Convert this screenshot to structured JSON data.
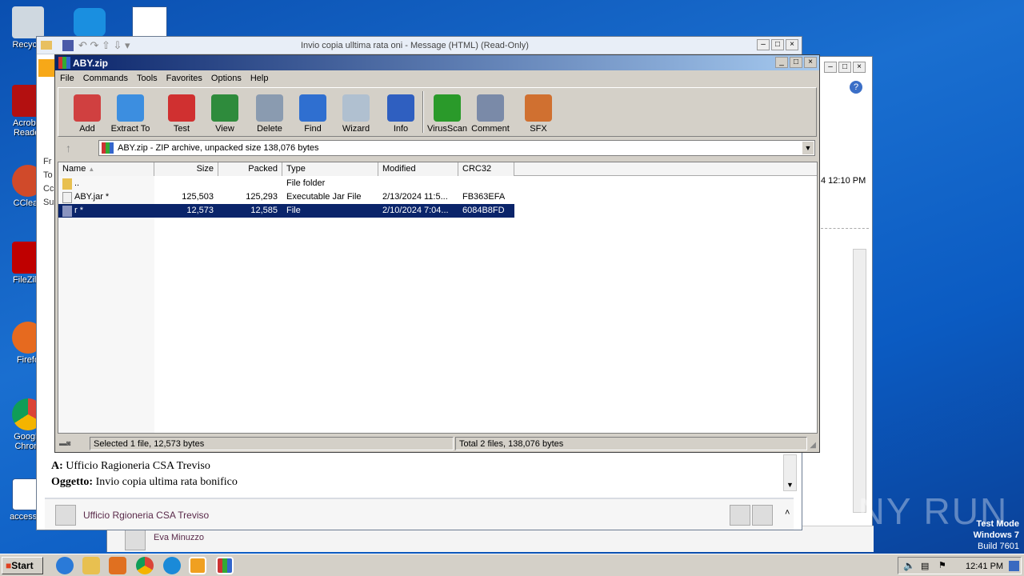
{
  "desktop": {
    "icons": [
      {
        "label": "Recycle"
      },
      {
        "label": "Acrobat Reader"
      },
      {
        "label": "CClean"
      },
      {
        "label": "FileZilla"
      },
      {
        "label": "Firefo"
      },
      {
        "label": "Google Chrom"
      },
      {
        "label": "accessac"
      }
    ]
  },
  "back_window": {
    "time_fragment": "4 12:10 PM",
    "person": "Eva Minuzzo"
  },
  "outlook": {
    "title": "Invio copia ulltima rata oni  -  Message (HTML) (Read-Only)",
    "header_labels": [
      "Fr",
      "To",
      "Cc",
      "Su"
    ],
    "body": {
      "to_label": "A:",
      "to_value": "Ufficio Ragioneria CSA Treviso",
      "subject_label": "Oggetto:",
      "subject_value": "Invio copia ultima rata bonifico"
    },
    "person": "Ufficio Rgioneria CSA Treviso"
  },
  "winrar": {
    "title": "ABY.zip",
    "menu": [
      "File",
      "Commands",
      "Tools",
      "Favorites",
      "Options",
      "Help"
    ],
    "toolbar": [
      {
        "label": "Add",
        "icon": "archive-books-icon",
        "color": "#d04040"
      },
      {
        "label": "Extract To",
        "icon": "folder-icon",
        "color": "#3c8ee0"
      },
      {
        "label": "Test",
        "icon": "checklist-icon",
        "color": "#d03030"
      },
      {
        "label": "View",
        "icon": "book-icon",
        "color": "#2e8b3c"
      },
      {
        "label": "Delete",
        "icon": "trash-icon",
        "color": "#8a9bb0"
      },
      {
        "label": "Find",
        "icon": "magnifier-icon",
        "color": "#2f6fd0"
      },
      {
        "label": "Wizard",
        "icon": "wand-icon",
        "color": "#b0c0d0"
      },
      {
        "label": "Info",
        "icon": "info-icon",
        "color": "#2f5fc0"
      },
      {
        "label": "VirusScan",
        "icon": "bug-icon",
        "color": "#2a9a2a"
      },
      {
        "label": "Comment",
        "icon": "comment-icon",
        "color": "#7a8aa8"
      },
      {
        "label": "SFX",
        "icon": "sfx-books-icon",
        "color": "#d07030"
      }
    ],
    "address": "ABY.zip - ZIP archive, unpacked size 138,076 bytes",
    "columns": [
      "Name",
      "Size",
      "Packed",
      "Type",
      "Modified",
      "CRC32"
    ],
    "rows": [
      {
        "name": "..",
        "size": "",
        "packed": "",
        "type": "File folder",
        "modified": "",
        "crc": "",
        "icon": "folder-icon"
      },
      {
        "name": "ABY.jar *",
        "size": "125,503",
        "packed": "125,293",
        "type": "Executable Jar File",
        "modified": "2/13/2024 11:5...",
        "crc": "FB363EFA",
        "icon": "jar-file-icon"
      },
      {
        "name": "r *",
        "size": "12,573",
        "packed": "12,585",
        "type": "File",
        "modified": "2/10/2024 7:04...",
        "crc": "6084B8FD",
        "icon": "file-icon",
        "selected": true
      }
    ],
    "status_left": "Selected 1 file, 12,573 bytes",
    "status_right": "Total 2 files, 138,076 bytes"
  },
  "watermark": {
    "text": "ANY RUN",
    "mode": "Test Mode",
    "os": "Windows 7",
    "build": "Build 7601"
  },
  "taskbar": {
    "start": "Start",
    "clock": "12:41 PM"
  },
  "colors": {
    "selection": "#0a246a",
    "titlebar": "#0a246a"
  }
}
